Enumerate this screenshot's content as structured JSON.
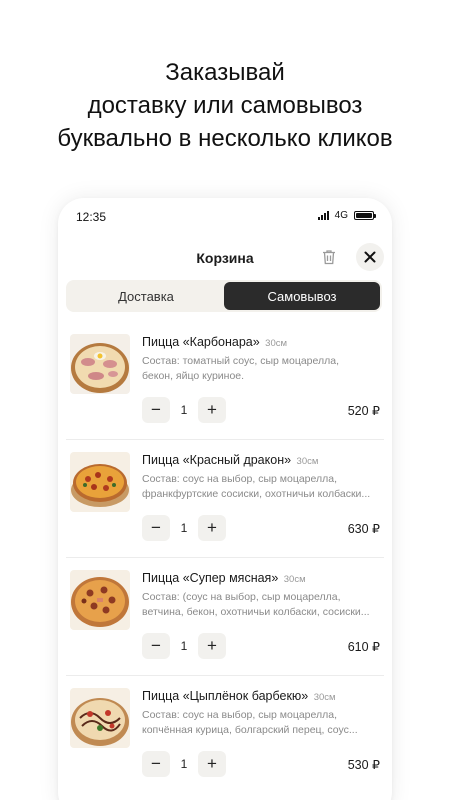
{
  "headline": {
    "line1": "Заказывай",
    "line2": "доставку или самовывоз",
    "line3": "буквально в несколько кликов"
  },
  "status_bar": {
    "time": "12:35",
    "network": "4G"
  },
  "header": {
    "title": "Корзина",
    "trash_icon": "trash-icon",
    "close_icon": "close-icon"
  },
  "tabs": [
    {
      "label": "Доставка",
      "active": false
    },
    {
      "label": "Самовывоз",
      "active": true
    }
  ],
  "items": [
    {
      "name": "Пицца «Карбонара»",
      "size": "30см",
      "desc1": "Состав: томатный соус, сыр моцарелла,",
      "desc2": "бекон, яйцо куриное.",
      "qty": "1",
      "price": "520 ₽"
    },
    {
      "name": "Пицца «Красный дракон»",
      "size": "30см",
      "desc1": "Состав: соус на выбор, сыр моцарелла,",
      "desc2": "франкфуртские сосиски, охотничьи колбаски...",
      "qty": "1",
      "price": "630 ₽"
    },
    {
      "name": "Пицца «Супер мясная»",
      "size": "30см",
      "desc1": "Состав: (соус на выбор, сыр моцарелла,",
      "desc2": "ветчина, бекон, охотничьи колбаски, сосиски...",
      "qty": "1",
      "price": "610 ₽"
    },
    {
      "name": "Пицца «Цыплёнок барбекю»",
      "size": "30см",
      "desc1": "Состав: соус на выбор, сыр моцарелла,",
      "desc2": "копчённая курица, болгарский перец, соус...",
      "qty": "1",
      "price": "530 ₽"
    }
  ],
  "stepper": {
    "minus": "−",
    "plus": "+"
  }
}
